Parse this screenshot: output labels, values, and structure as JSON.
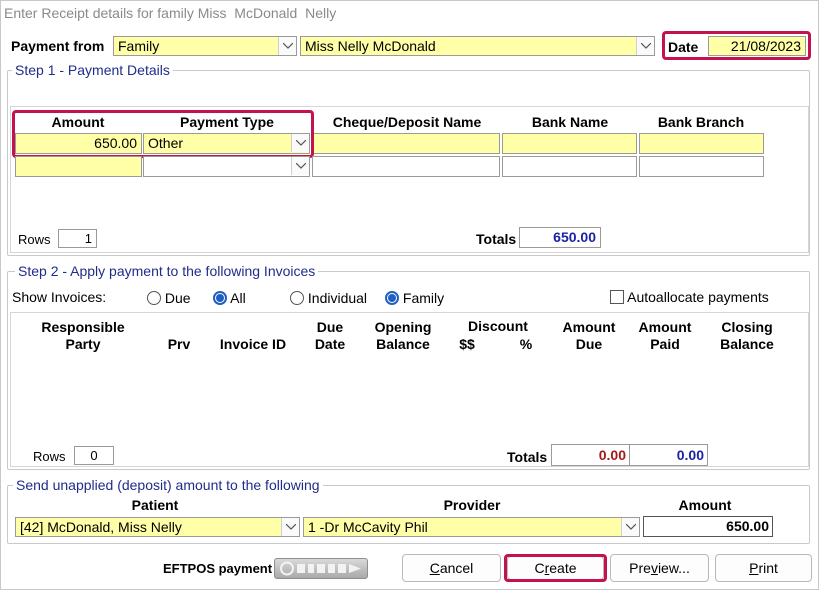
{
  "window": {
    "title": "Enter Receipt details for family Miss  McDonald  Nelly"
  },
  "header": {
    "payment_from_label": "Payment from",
    "payment_from_type": "Family",
    "payment_from_name": "Miss Nelly  McDonald",
    "date_label": "Date",
    "date_value": "21/08/2023"
  },
  "step1": {
    "title": "Step 1 - Payment Details",
    "columns": {
      "amount": "Amount",
      "payment_type": "Payment Type",
      "cheque_name": "Cheque/Deposit Name",
      "bank_name": "Bank Name",
      "bank_branch": "Bank Branch"
    },
    "row1": {
      "amount": "650.00",
      "payment_type": "Other"
    },
    "rows_label": "Rows",
    "rows_value": "1",
    "totals_label": "Totals",
    "totals_value": "650.00"
  },
  "step2": {
    "title": "Step 2 - Apply payment to the following Invoices",
    "show_invoices_label": "Show Invoices:",
    "radio_due": "Due",
    "radio_all": "All",
    "radio_individual": "Individual",
    "radio_family": "Family",
    "autoallocate_label": "Autoallocate payments",
    "columns": {
      "responsible_1": "Responsible",
      "responsible_2": "Party",
      "prv": "Prv",
      "invoice_id": "Invoice ID",
      "due_1": "Due",
      "due_2": "Date",
      "opening_1": "Opening",
      "opening_2": "Balance",
      "discount": "Discount",
      "discount_dollars": "$$",
      "discount_pct": "%",
      "amount_due_1": "Amount",
      "amount_due_2": "Due",
      "amount_paid_1": "Amount",
      "amount_paid_2": "Paid",
      "closing_1": "Closing",
      "closing_2": "Balance"
    },
    "rows_label": "Rows",
    "rows_value": "0",
    "totals_label": "Totals",
    "total_due": "0.00",
    "total_paid": "0.00"
  },
  "unapplied": {
    "title": "Send unapplied (deposit) amount to the following",
    "patient_label": "Patient",
    "provider_label": "Provider",
    "amount_label": "Amount",
    "patient_value": "[42] McDonald, Miss Nelly",
    "provider_value": "1 -Dr McCavity Phil",
    "amount_value": "650.00"
  },
  "footer": {
    "eftpos_label": "EFTPOS payment",
    "cancel_pre": "",
    "cancel_u": "C",
    "cancel_post": "ancel",
    "create_pre": "C",
    "create_u": "r",
    "create_post": "eate",
    "preview_pre": "Pre",
    "preview_u": "v",
    "preview_post": "iew...",
    "print_pre": "",
    "print_u": "P",
    "print_post": "rint"
  },
  "colors": {
    "field_yellow": "#ffffa8",
    "highlight": "#c3124e",
    "group_title": "#1f2d8a",
    "blue_value": "#1a22a8",
    "red_value": "#a21a1a"
  }
}
